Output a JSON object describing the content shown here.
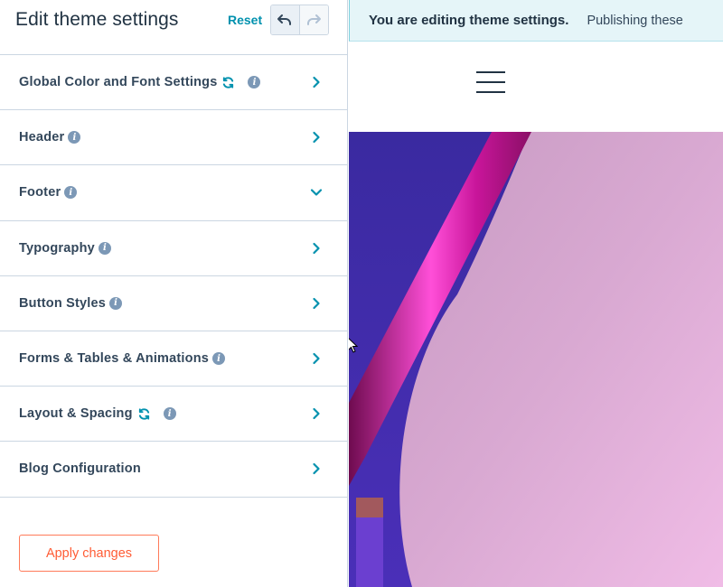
{
  "panel": {
    "title": "Edit theme settings",
    "reset_label": "Reset",
    "undo_icon": "undo-icon",
    "redo_icon": "redo-icon",
    "sections": [
      {
        "label": "Global Color and Font Settings",
        "sync": true,
        "info": true,
        "expanded": false
      },
      {
        "label": "Header",
        "sync": false,
        "info": true,
        "expanded": false
      },
      {
        "label": "Footer",
        "sync": false,
        "info": true,
        "expanded": true
      },
      {
        "label": "Typography",
        "sync": false,
        "info": true,
        "expanded": false
      },
      {
        "label": "Button Styles",
        "sync": false,
        "info": true,
        "expanded": false
      },
      {
        "label": "Forms & Tables & Animations",
        "sync": false,
        "info": true,
        "expanded": false
      },
      {
        "label": "Layout & Spacing",
        "sync": true,
        "info": true,
        "expanded": false
      },
      {
        "label": "Blog Configuration",
        "sync": false,
        "info": false,
        "expanded": false
      }
    ],
    "apply_label": "Apply changes"
  },
  "preview": {
    "banner_strong": "You are editing theme settings.",
    "banner_text": "Publishing these",
    "menu_icon": "hamburger-menu-icon"
  },
  "colors": {
    "accent_teal": "#0091ae",
    "accent_orange": "#ff5c35",
    "border": "#cbd6e2",
    "text": "#33475b",
    "banner_bg": "#e5f5f8"
  }
}
